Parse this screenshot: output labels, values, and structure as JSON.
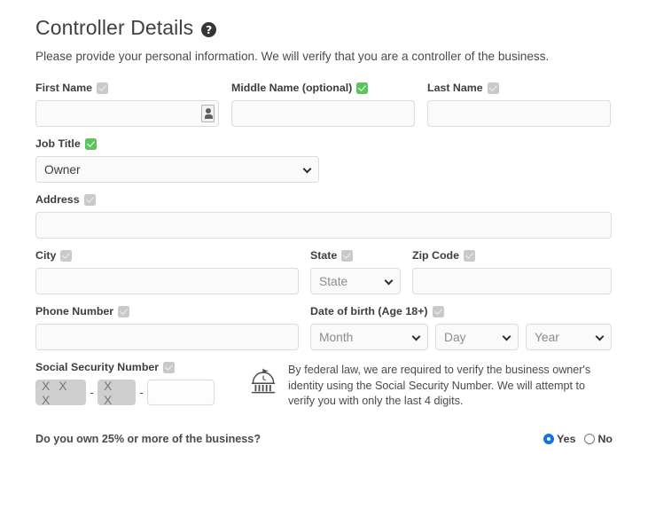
{
  "header": {
    "title": "Controller Details",
    "help_icon": "question-mark-icon",
    "description": "Please provide your personal information. We will verify that you are a controller of the business."
  },
  "colors": {
    "valid_check": "#5bc45b",
    "pending_check": "#c9c9c9",
    "radio_selected": "#1273ea",
    "input_border": "#dcdcdc",
    "input_background": "#fafafa",
    "ssn_mask_background": "#cfcfcf"
  },
  "fields": {
    "first_name": {
      "label": "First Name",
      "value": "",
      "placeholder": "",
      "check": "pending",
      "autofill_icon": "contact-card-icon"
    },
    "middle_name": {
      "label": "Middle Name (optional)",
      "value": "",
      "placeholder": "",
      "check": "valid"
    },
    "last_name": {
      "label": "Last Name",
      "value": "",
      "placeholder": "",
      "check": "pending"
    },
    "job_title": {
      "label": "Job Title",
      "value": "Owner",
      "check": "valid",
      "options": [
        "Owner"
      ]
    },
    "address": {
      "label": "Address",
      "value": "",
      "placeholder": "",
      "check": "pending"
    },
    "city": {
      "label": "City",
      "value": "",
      "placeholder": "",
      "check": "pending"
    },
    "state": {
      "label": "State",
      "value": "State",
      "check": "pending",
      "options": [
        "State"
      ]
    },
    "zip_code": {
      "label": "Zip Code",
      "value": "",
      "placeholder": "",
      "check": "pending"
    },
    "phone_number": {
      "label": "Phone Number",
      "value": "",
      "placeholder": "",
      "check": "pending"
    },
    "date_of_birth": {
      "label": "Date of birth (Age 18+)",
      "check": "pending",
      "month": {
        "value": "Month",
        "options": [
          "Month"
        ]
      },
      "day": {
        "value": "Day",
        "options": [
          "Day"
        ]
      },
      "year": {
        "value": "Year",
        "options": [
          "Year"
        ]
      }
    },
    "ssn": {
      "label": "Social Security Number",
      "check": "pending",
      "part1_masked": "X X X",
      "separator": "-",
      "part2_masked": "X X",
      "part3_value": "",
      "note_icon": "government-building-icon",
      "note": "By federal law, we are required to verify the business owner's identity using the Social Security Number. We will attempt to verify you with only the last 4 digits."
    },
    "ownership": {
      "question": "Do you own 25% or more of the business?",
      "options": [
        {
          "label": "Yes",
          "selected": true
        },
        {
          "label": "No",
          "selected": false
        }
      ]
    }
  }
}
